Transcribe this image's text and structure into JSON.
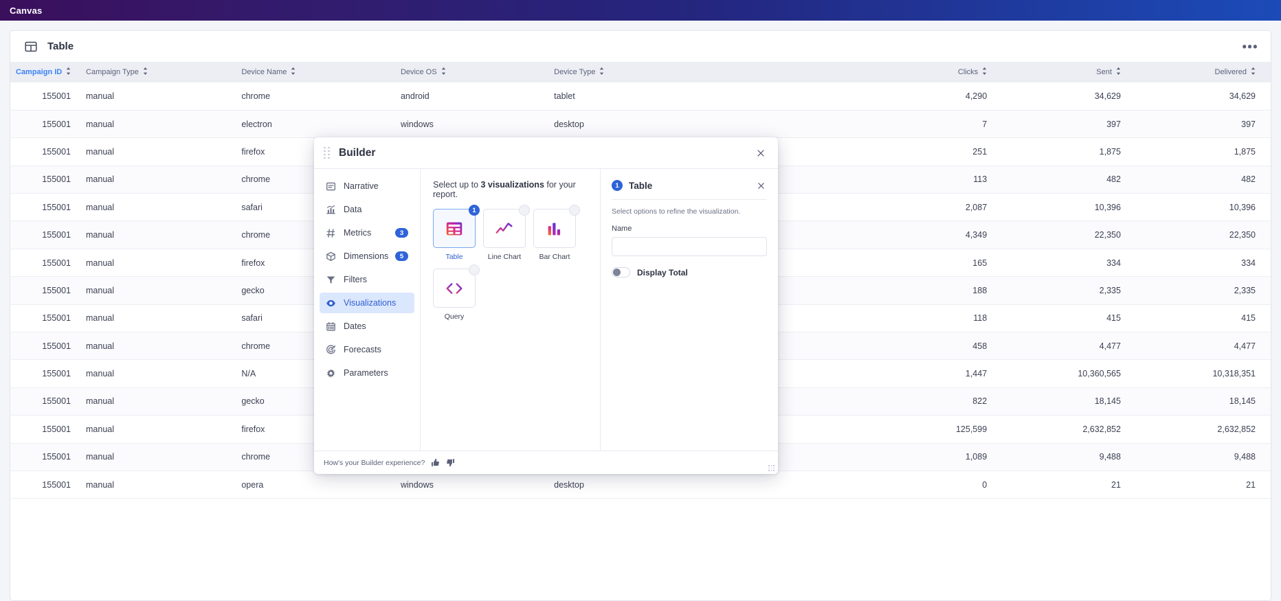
{
  "topbar": {
    "title": "Canvas"
  },
  "card": {
    "title": "Table",
    "menu_label": "•••",
    "columns": [
      {
        "label": "Campaign ID",
        "key": "cid",
        "sorted": true
      },
      {
        "label": "Campaign Type",
        "key": "ctype",
        "sorted": false
      },
      {
        "label": "Device Name",
        "key": "dname",
        "sorted": false
      },
      {
        "label": "Device OS",
        "key": "dos",
        "sorted": false
      },
      {
        "label": "Device Type",
        "key": "dtype",
        "sorted": false
      },
      {
        "label": "Clicks",
        "key": "clicks",
        "sorted": false
      },
      {
        "label": "Sent",
        "key": "sent",
        "sorted": false
      },
      {
        "label": "Delivered",
        "key": "deliv",
        "sorted": false
      }
    ],
    "rows": [
      {
        "cid": "155001",
        "ctype": "manual",
        "dname": "chrome",
        "dos": "android",
        "dtype": "tablet",
        "clicks": "4,290",
        "sent": "34,629",
        "deliv": "34,629"
      },
      {
        "cid": "155001",
        "ctype": "manual",
        "dname": "electron",
        "dos": "windows",
        "dtype": "desktop",
        "clicks": "7",
        "sent": "397",
        "deliv": "397"
      },
      {
        "cid": "155001",
        "ctype": "manual",
        "dname": "firefox",
        "dos": "",
        "dtype": "",
        "clicks": "251",
        "sent": "1,875",
        "deliv": "1,875"
      },
      {
        "cid": "155001",
        "ctype": "manual",
        "dname": "chrome",
        "dos": "",
        "dtype": "",
        "clicks": "113",
        "sent": "482",
        "deliv": "482"
      },
      {
        "cid": "155001",
        "ctype": "manual",
        "dname": "safari",
        "dos": "",
        "dtype": "",
        "clicks": "2,087",
        "sent": "10,396",
        "deliv": "10,396"
      },
      {
        "cid": "155001",
        "ctype": "manual",
        "dname": "chrome",
        "dos": "",
        "dtype": "",
        "clicks": "4,349",
        "sent": "22,350",
        "deliv": "22,350"
      },
      {
        "cid": "155001",
        "ctype": "manual",
        "dname": "firefox",
        "dos": "",
        "dtype": "",
        "clicks": "165",
        "sent": "334",
        "deliv": "334"
      },
      {
        "cid": "155001",
        "ctype": "manual",
        "dname": "gecko",
        "dos": "",
        "dtype": "",
        "clicks": "188",
        "sent": "2,335",
        "deliv": "2,335"
      },
      {
        "cid": "155001",
        "ctype": "manual",
        "dname": "safari",
        "dos": "",
        "dtype": "",
        "clicks": "118",
        "sent": "415",
        "deliv": "415"
      },
      {
        "cid": "155001",
        "ctype": "manual",
        "dname": "chrome",
        "dos": "",
        "dtype": "",
        "clicks": "458",
        "sent": "4,477",
        "deliv": "4,477"
      },
      {
        "cid": "155001",
        "ctype": "manual",
        "dname": "N/A",
        "dos": "",
        "dtype": "",
        "clicks": "1,447",
        "sent": "10,360,565",
        "deliv": "10,318,351"
      },
      {
        "cid": "155001",
        "ctype": "manual",
        "dname": "gecko",
        "dos": "",
        "dtype": "",
        "clicks": "822",
        "sent": "18,145",
        "deliv": "18,145"
      },
      {
        "cid": "155001",
        "ctype": "manual",
        "dname": "firefox",
        "dos": "",
        "dtype": "",
        "clicks": "125,599",
        "sent": "2,632,852",
        "deliv": "2,632,852"
      },
      {
        "cid": "155001",
        "ctype": "manual",
        "dname": "chrome",
        "dos": "",
        "dtype": "",
        "clicks": "1,089",
        "sent": "9,488",
        "deliv": "9,488"
      },
      {
        "cid": "155001",
        "ctype": "manual",
        "dname": "opera",
        "dos": "windows",
        "dtype": "desktop",
        "clicks": "0",
        "sent": "21",
        "deliv": "21"
      }
    ]
  },
  "modal": {
    "title": "Builder",
    "nav": [
      {
        "label": "Narrative",
        "icon": "narrative-icon",
        "badge": "",
        "active": false
      },
      {
        "label": "Data",
        "icon": "data-icon",
        "badge": "",
        "active": false
      },
      {
        "label": "Metrics",
        "icon": "hash-icon",
        "badge": "3",
        "active": false
      },
      {
        "label": "Dimensions",
        "icon": "cube-icon",
        "badge": "5",
        "active": false
      },
      {
        "label": "Filters",
        "icon": "funnel-icon",
        "badge": "",
        "active": false
      },
      {
        "label": "Visualizations",
        "icon": "eye-icon",
        "badge": "",
        "active": true
      },
      {
        "label": "Dates",
        "icon": "calendar-icon",
        "badge": "",
        "active": false
      },
      {
        "label": "Forecasts",
        "icon": "target-icon",
        "badge": "",
        "active": false
      },
      {
        "label": "Parameters",
        "icon": "gear-icon",
        "badge": "",
        "active": false
      }
    ],
    "center": {
      "prompt_pre": "Select up to ",
      "prompt_bold": "3 visualizations",
      "prompt_post": " for your report.",
      "visualizations": [
        {
          "label": "Table",
          "icon": "table-glyph",
          "selected": true,
          "order": "1"
        },
        {
          "label": "Line Chart",
          "icon": "line-chart-glyph",
          "selected": false,
          "order": ""
        },
        {
          "label": "Bar Chart",
          "icon": "bar-chart-glyph",
          "selected": false,
          "order": ""
        },
        {
          "label": "Query",
          "icon": "code-glyph",
          "selected": false,
          "order": ""
        }
      ]
    },
    "options": {
      "order": "1",
      "title": "Table",
      "subtitle": "Select options to refine the visualization.",
      "name_label": "Name",
      "name_value": "",
      "name_placeholder": "",
      "toggle_label": "Display Total",
      "toggle_on": false
    },
    "footer": {
      "text": "How's your Builder experience?"
    }
  },
  "colors": {
    "accent": "#2f63d8",
    "link": "#3b82f6",
    "header_bg": "#eceef4"
  }
}
